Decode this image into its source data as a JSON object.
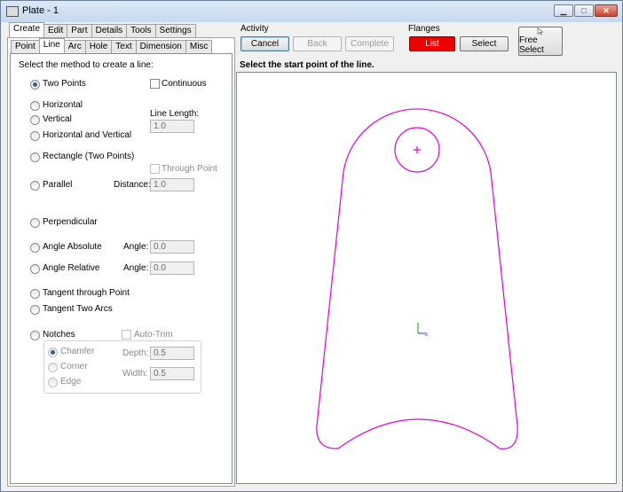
{
  "window": {
    "title": "Plate - 1",
    "controls": {
      "minimize": "▁",
      "maximize": "□",
      "close": "✕"
    }
  },
  "top_tabs": [
    "Create",
    "Edit",
    "Part",
    "Details",
    "Tools",
    "Settings"
  ],
  "sub_tabs": [
    "Point",
    "Line",
    "Arc",
    "Hole",
    "Text",
    "Dimension",
    "Misc"
  ],
  "activity": {
    "title": "Activity",
    "cancel": "Cancel",
    "back": "Back",
    "complete": "Complete"
  },
  "flanges": {
    "title": "Flanges",
    "list": "List",
    "select": "Select"
  },
  "free_select": "Free Select",
  "prompt": "Select the start point of the line.",
  "line_panel": {
    "instruction": "Select the method to create a line:",
    "two_points": "Two Points",
    "continuous": "Continuous",
    "horizontal": "Horizontal",
    "vertical": "Vertical",
    "line_length_label": "Line Length:",
    "line_length_value": "1.0",
    "horizontal_vertical": "Horizontal and Vertical",
    "rectangle": "Rectangle (Two Points)",
    "through_point": "Through Point",
    "parallel": "Parallel",
    "distance_label": "Distance:",
    "distance_value": "1.0",
    "perpendicular": "Perpendicular",
    "angle_absolute": "Angle Absolute",
    "angle_label_1": "Angle:",
    "angle_abs_value": "0.0",
    "angle_relative": "Angle Relative",
    "angle_label_2": "Angle:",
    "angle_rel_value": "0.0",
    "tangent_point": "Tangent through Point",
    "tangent_arcs": "Tangent Two Arcs",
    "notches": "Notches",
    "auto_trim": "Auto-Trim",
    "chamfer": "Chamfer",
    "corner": "Corner",
    "edge": "Edge",
    "depth_label": "Depth:",
    "depth_value": "0.5",
    "width_label": "Width:",
    "width_value": "0.5"
  },
  "colors": {
    "shape_outline": "#e000e0",
    "axis_x": "#2a2ad0",
    "axis_y": "#00a000",
    "list_button": "#ee0000"
  }
}
